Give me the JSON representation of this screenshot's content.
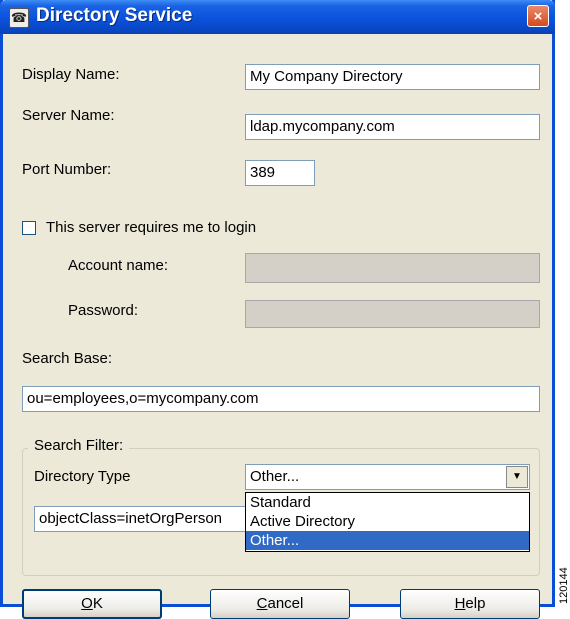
{
  "window": {
    "title": "Directory Service",
    "close_glyph": "×",
    "title_icon": "☎"
  },
  "fields": {
    "display_name": {
      "label": "Display Name:",
      "value": "My Company Directory"
    },
    "server_name": {
      "label": "Server Name:",
      "value": "ldap.mycompany.com"
    },
    "port_number": {
      "label": "Port Number:",
      "value": "389"
    },
    "requires_login": {
      "label": "This server requires me to login",
      "checked": false
    },
    "account_name": {
      "label": "Account name:",
      "value": ""
    },
    "password": {
      "label": "Password:",
      "value": ""
    },
    "search_base": {
      "label": "Search Base:",
      "value": "ou=employees,o=mycompany.com"
    }
  },
  "search_filter": {
    "legend": "Search Filter:",
    "directory_type_label": "Directory Type",
    "selected": "Other...",
    "options": [
      "Standard",
      "Active Directory",
      "Other..."
    ],
    "filter_value": "objectClass=inetOrgPerson"
  },
  "buttons": {
    "ok": {
      "accel": "O",
      "rest": "K"
    },
    "cancel": {
      "accel": "C",
      "rest": "ancel"
    },
    "help": {
      "accel": "H",
      "rest": "elp"
    }
  },
  "side_id": "120144",
  "colors": {
    "titlebar": "#0a52dc",
    "dialog_bg": "#ece9d8",
    "selection": "#316ac5",
    "close": "#d24a20"
  }
}
